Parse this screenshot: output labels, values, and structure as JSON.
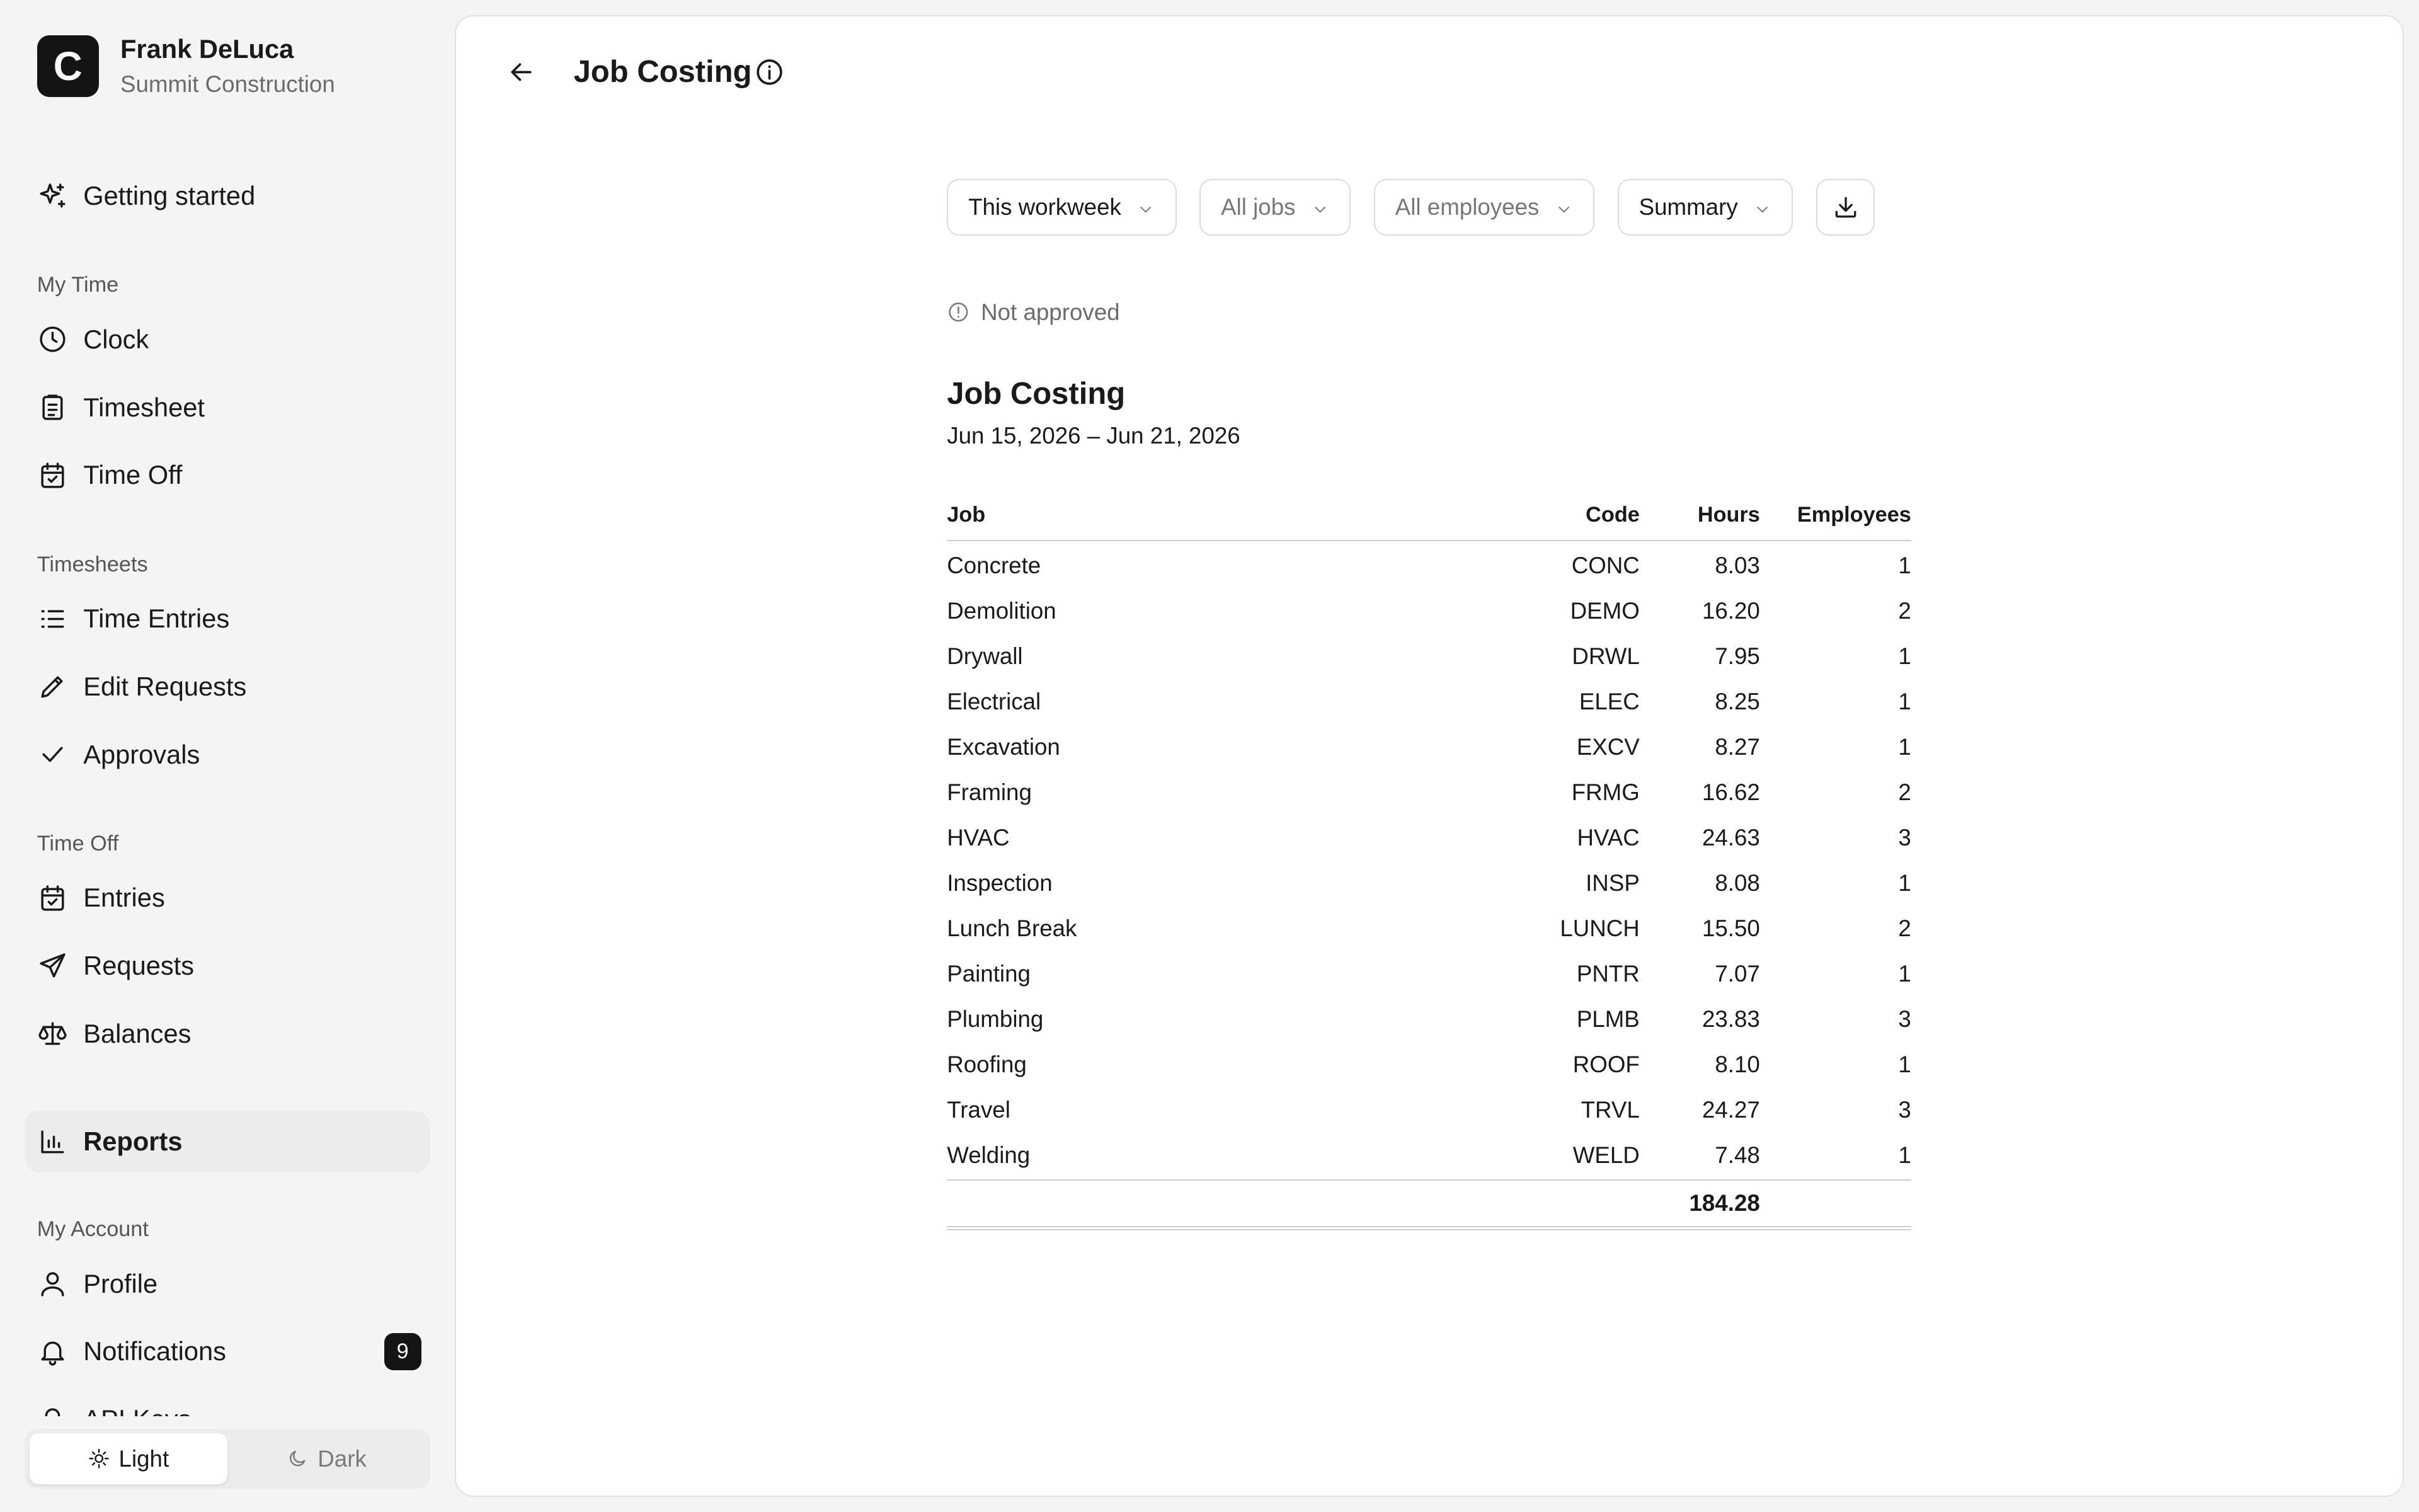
{
  "user": {
    "initial": "C",
    "name": "Frank DeLuca",
    "company": "Summit Construction"
  },
  "nav": {
    "getting_started": "Getting started",
    "my_time": {
      "label": "My Time",
      "items": [
        "Clock",
        "Timesheet",
        "Time Off"
      ]
    },
    "timesheets": {
      "label": "Timesheets",
      "items": [
        "Time Entries",
        "Edit Requests",
        "Approvals"
      ]
    },
    "time_off": {
      "label": "Time Off",
      "items": [
        "Entries",
        "Requests",
        "Balances"
      ]
    },
    "reports": "Reports",
    "my_account": {
      "label": "My Account",
      "items": [
        "Profile",
        "Notifications"
      ],
      "clipped_item": "API Keys"
    },
    "notifications_count": "9"
  },
  "theme": {
    "light": "Light",
    "dark": "Dark",
    "selected": "Light"
  },
  "page": {
    "title": "Job Costing"
  },
  "filters": {
    "period": "This workweek",
    "jobs": "All jobs",
    "employees": "All employees",
    "view": "Summary"
  },
  "status": "Not approved",
  "report": {
    "title": "Job Costing",
    "range": "Jun 15, 2026 – Jun 21, 2026",
    "columns": {
      "job": "Job",
      "code": "Code",
      "hours": "Hours",
      "employees": "Employees"
    },
    "rows": [
      {
        "job": "Concrete",
        "code": "CONC",
        "hours": "8.03",
        "employees": "1"
      },
      {
        "job": "Demolition",
        "code": "DEMO",
        "hours": "16.20",
        "employees": "2"
      },
      {
        "job": "Drywall",
        "code": "DRWL",
        "hours": "7.95",
        "employees": "1"
      },
      {
        "job": "Electrical",
        "code": "ELEC",
        "hours": "8.25",
        "employees": "1"
      },
      {
        "job": "Excavation",
        "code": "EXCV",
        "hours": "8.27",
        "employees": "1"
      },
      {
        "job": "Framing",
        "code": "FRMG",
        "hours": "16.62",
        "employees": "2"
      },
      {
        "job": "HVAC",
        "code": "HVAC",
        "hours": "24.63",
        "employees": "3"
      },
      {
        "job": "Inspection",
        "code": "INSP",
        "hours": "8.08",
        "employees": "1"
      },
      {
        "job": "Lunch Break",
        "code": "LUNCH",
        "hours": "15.50",
        "employees": "2"
      },
      {
        "job": "Painting",
        "code": "PNTR",
        "hours": "7.07",
        "employees": "1"
      },
      {
        "job": "Plumbing",
        "code": "PLMB",
        "hours": "23.83",
        "employees": "3"
      },
      {
        "job": "Roofing",
        "code": "ROOF",
        "hours": "8.10",
        "employees": "1"
      },
      {
        "job": "Travel",
        "code": "TRVL",
        "hours": "24.27",
        "employees": "3"
      },
      {
        "job": "Welding",
        "code": "WELD",
        "hours": "7.48",
        "employees": "1"
      }
    ],
    "total_hours": "184.28"
  },
  "colors": {
    "accent": "#141414",
    "active_bg": "#ececec",
    "muted_text": "#6b6b6b"
  },
  "icons": {
    "getting_started": "sparkles-icon",
    "clock": "clock-icon",
    "timesheet": "clipboard-icon",
    "time_off": "calendar-check-icon",
    "time_entries": "list-icon",
    "edit_requests": "pencil-icon",
    "approvals": "check-icon",
    "entries": "calendar-check-icon",
    "requests": "send-icon",
    "balances": "scale-icon",
    "reports": "bar-chart-icon",
    "profile": "user-icon",
    "notifications": "bell-icon",
    "download": "download-icon",
    "back": "arrow-left-icon",
    "info": "info-icon",
    "status": "alert-circle-icon"
  }
}
